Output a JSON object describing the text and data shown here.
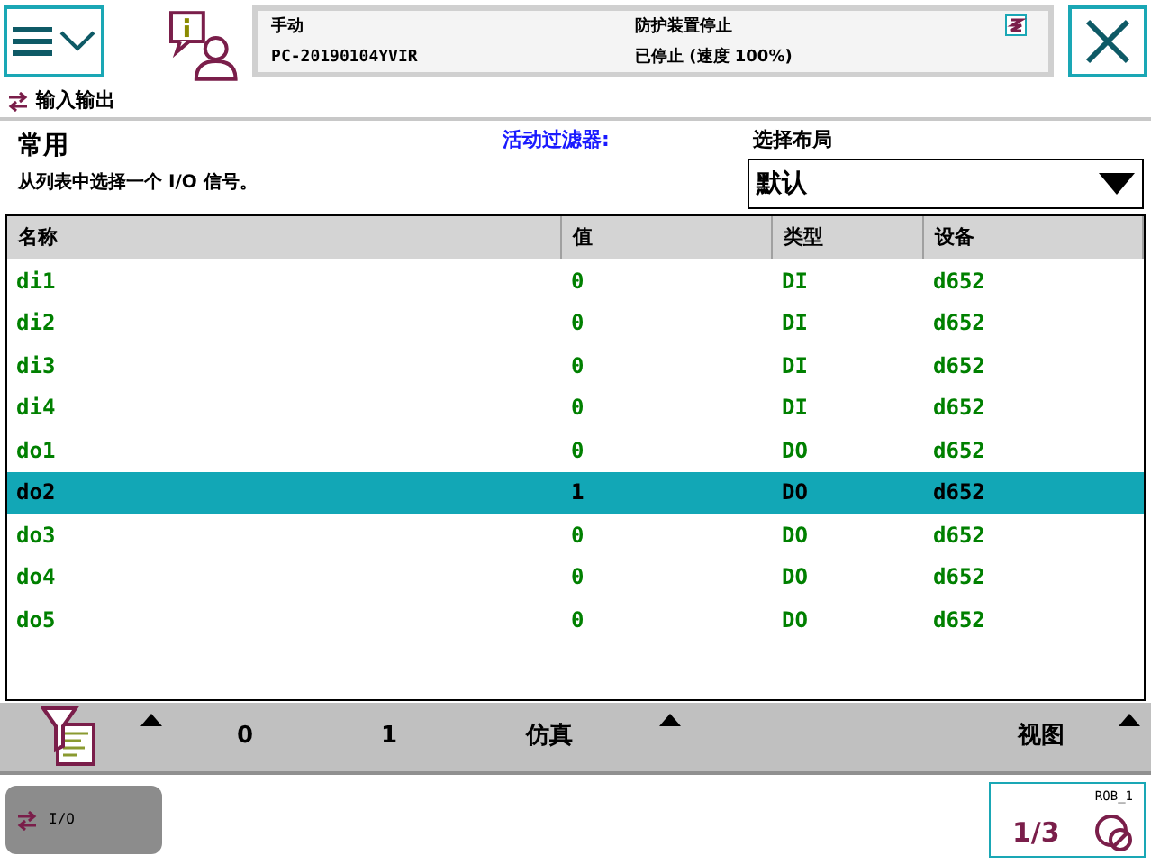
{
  "status": {
    "mode": "手动",
    "controller": "PC-20190104YVIR",
    "safety": "防护装置停止",
    "state": "已停止 (速度 100%)"
  },
  "app_title": "输入输出",
  "header": {
    "title": "常用",
    "instruction": "从列表中选择一个 I/O 信号。",
    "filter_label": "活动过滤器:",
    "layout_label": "选择布局",
    "layout_value": "默认"
  },
  "table": {
    "columns": [
      "名称",
      "值",
      "类型",
      "设备"
    ],
    "rows": [
      {
        "name": "di1",
        "value": "0",
        "type": "DI",
        "device": "d652",
        "selected": false
      },
      {
        "name": "di2",
        "value": "0",
        "type": "DI",
        "device": "d652",
        "selected": false
      },
      {
        "name": "di3",
        "value": "0",
        "type": "DI",
        "device": "d652",
        "selected": false
      },
      {
        "name": "di4",
        "value": "0",
        "type": "DI",
        "device": "d652",
        "selected": false
      },
      {
        "name": "do1",
        "value": "0",
        "type": "DO",
        "device": "d652",
        "selected": false
      },
      {
        "name": "do2",
        "value": "1",
        "type": "DO",
        "device": "d652",
        "selected": true
      },
      {
        "name": "do3",
        "value": "0",
        "type": "DO",
        "device": "d652",
        "selected": false
      },
      {
        "name": "do4",
        "value": "0",
        "type": "DO",
        "device": "d652",
        "selected": false
      },
      {
        "name": "do5",
        "value": "0",
        "type": "DO",
        "device": "d652",
        "selected": false
      }
    ]
  },
  "toolbar": {
    "zero": "0",
    "one": "1",
    "simulate": "仿真",
    "view": "视图"
  },
  "taskbar": {
    "app": "I/O",
    "quickset": "ROB_1",
    "fraction": "1/3"
  }
}
